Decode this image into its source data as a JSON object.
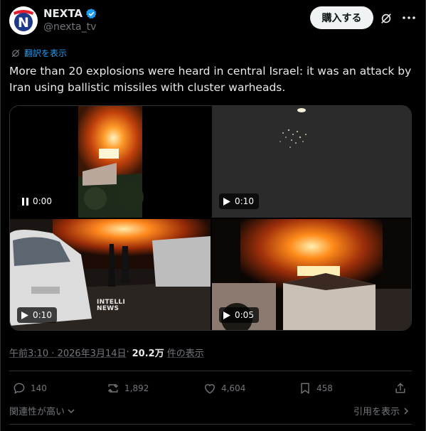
{
  "author": {
    "display_name": "NEXTA",
    "handle": "@nexta_tv",
    "avatar_letter": "N",
    "verified": true
  },
  "header": {
    "buy_label": "購入する"
  },
  "translate_label": "翻訳を表示",
  "tweet_text": "More than 20 explosions were heard in central Israel: it was an attack by Iran using ballistic missiles with cluster warheads.",
  "media": [
    {
      "duration": "0:00",
      "state": "pause-icon"
    },
    {
      "duration": "0:10",
      "state": "play-icon"
    },
    {
      "duration": "0:10",
      "state": "play-icon",
      "watermark": "INTELLI\nNEWS"
    },
    {
      "duration": "0:05",
      "state": "play-icon"
    }
  ],
  "meta": {
    "time": "午前3:10 · 2026年3月14日",
    "separator": " · ",
    "views_count": "20.2万",
    "views_label": "件の表示"
  },
  "actions": {
    "replies": "140",
    "reposts": "1,892",
    "likes": "4,604",
    "bookmarks": "458"
  },
  "footer": {
    "sort_label": "関連性が高い",
    "quotes_label": "引用を表示"
  },
  "colors": {
    "background": "#000000",
    "text": "#e7e9ea",
    "muted": "#71767b",
    "link": "#1d9bf0",
    "verified": "#1d9bf0",
    "avatar_red": "#e11d2e",
    "avatar_blue": "#1d3a8a"
  }
}
